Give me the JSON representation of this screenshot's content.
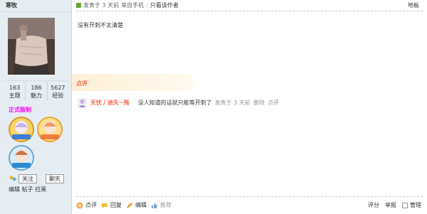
{
  "author": {
    "name": "寒牧",
    "stats": [
      {
        "num": "163",
        "label": "主题"
      },
      {
        "num": "186",
        "label": "魅力"
      },
      {
        "num": "5627",
        "label": "经验"
      }
    ],
    "group": "正式版制",
    "follow_label": "关注",
    "chat_label": "聊天",
    "edit_label": "编辑",
    "posts_label": "帖子",
    "block_label": "拉黑"
  },
  "post": {
    "info": "发表于 3 天前",
    "from": "来自手机",
    "only_author": "只看该作者",
    "floor": "地板",
    "content": "没有开刺不太清楚"
  },
  "review": {
    "title": "点评",
    "comment": {
      "user": "无忧丿迷失~殇",
      "text": "没人知道的话就只能等开刺了",
      "time": "发表于 3 天前",
      "delete": "删除",
      "review": "点评"
    }
  },
  "footer": {
    "review": "点评",
    "reply": "回复",
    "edit": "编辑",
    "recommend": "推荐",
    "rate": "评分",
    "report": "举报",
    "manage": "管理"
  },
  "colors": {
    "sidebar_bg": "#e5edf2",
    "accent_orange": "#f26c4f",
    "group_magenta": "#ff00ff",
    "gold": "#f0a030"
  }
}
